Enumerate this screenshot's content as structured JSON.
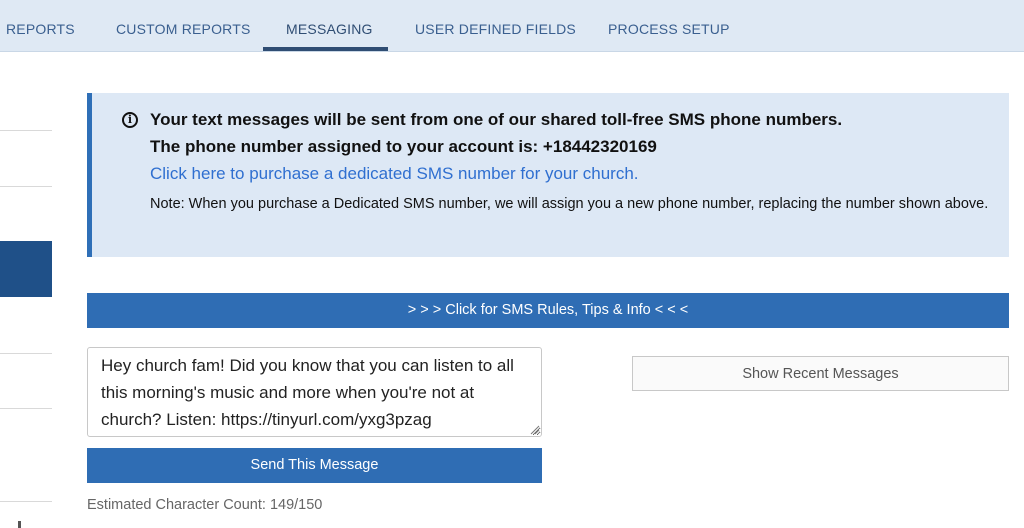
{
  "nav": {
    "tabs": [
      {
        "label": "REPORTS"
      },
      {
        "label": "CUSTOM REPORTS"
      },
      {
        "label": "MESSAGING"
      },
      {
        "label": "USER DEFINED FIELDS"
      },
      {
        "label": "PROCESS SETUP"
      }
    ],
    "active_tab": "MESSAGING"
  },
  "notice": {
    "icon": "info-icon",
    "line1": "Your text messages will be sent from one of our shared toll-free SMS phone numbers.",
    "line2": "The phone number assigned to your account is: +18442320169",
    "link": "Click here to purchase a dedicated SMS number for your church.",
    "note": "Note: When you purchase a Dedicated SMS number, we will assign you a new phone number, replacing the number shown above."
  },
  "rules_bar": {
    "label": "> > > Click for SMS Rules, Tips & Info < < <"
  },
  "message": {
    "value": "Hey church fam! Did you know that you can listen to all this morning's music and more when you're not at church? Listen: https://tinyurl.com/yxg3pzag"
  },
  "send_button": {
    "label": "Send This Message"
  },
  "char_count": {
    "text": "Estimated Character Count: 149/150"
  },
  "recent_button": {
    "label": "Show Recent Messages"
  },
  "colors": {
    "nav_bg": "#dfe9f4",
    "nav_text": "#3a5f8f",
    "accent": "#2f6db4",
    "notice_bg": "#dde8f5",
    "link": "#2f6fd0"
  }
}
